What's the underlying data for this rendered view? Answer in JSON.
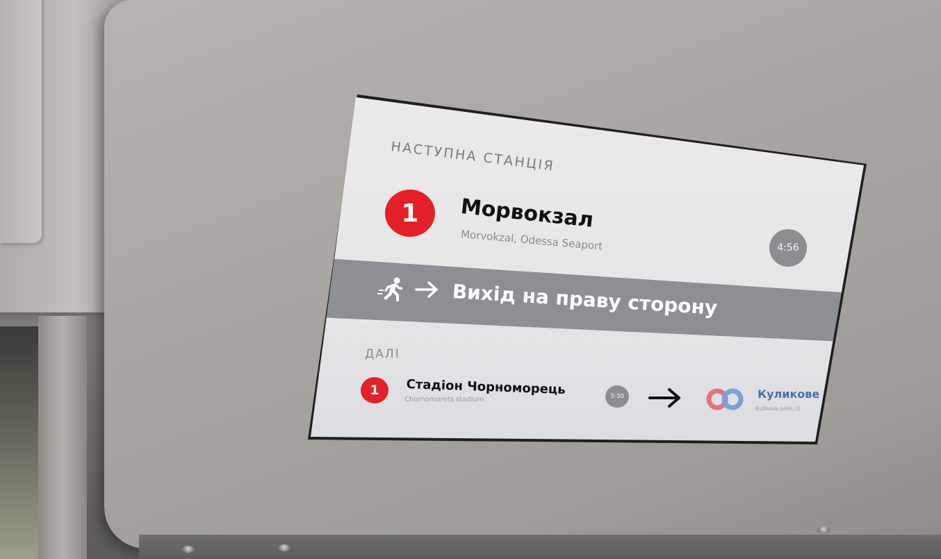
{
  "next_station": {
    "label": "НАСТУПНА СТАНЦІЯ",
    "line_number": "1",
    "name": "Морвокзал",
    "name_en": "Morvokzal, Odessa Seaport",
    "time": "4:56"
  },
  "exit_notice": {
    "icon": "running-person-icon",
    "arrow_icon": "arrow-right-icon",
    "text": "Вихід на праву сторону"
  },
  "then": {
    "label": "ДАЛІ",
    "line_number": "1",
    "name": "Стадіон Чорноморець",
    "name_en": "Chornomorets stadium",
    "time": "3:30",
    "arrow_icon": "arrow-right-icon",
    "transfer_icon": "transfer-rings-icon",
    "transfer_name": "Куликове",
    "transfer_name_en": "Kulikove pole, O"
  },
  "colors": {
    "line_red": "#e52127",
    "band_gray": "#8d8f94",
    "transfer_blue": "#4b6fae",
    "transfer_red": "#e2747c"
  }
}
